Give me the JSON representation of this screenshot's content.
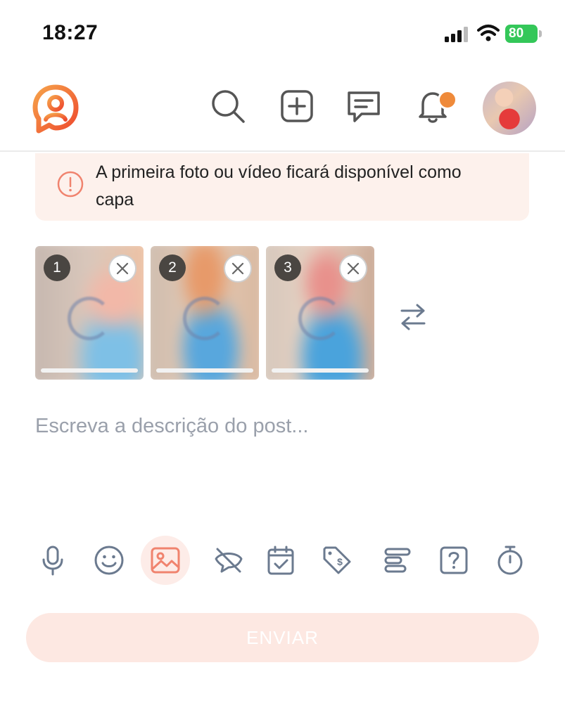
{
  "status_bar": {
    "time": "18:27",
    "battery_level": "80",
    "battery_color": "#34c759"
  },
  "header": {
    "logo": "app-logo",
    "icons": [
      "search-icon",
      "add-icon",
      "chat-icon",
      "bell-icon",
      "avatar"
    ],
    "notification_dot_color": "#ef8a3a"
  },
  "banner": {
    "text": "A primeira foto ou vídeo ficará disponível como capa",
    "icon": "alert-circle-icon",
    "background": "#fdf1ec"
  },
  "media": {
    "items": [
      {
        "index": "1",
        "status": "uploading"
      },
      {
        "index": "2",
        "status": "uploading"
      },
      {
        "index": "3",
        "status": "uploading"
      }
    ],
    "reorder_icon": "swap-arrows-icon"
  },
  "composer": {
    "description_placeholder": "Escreva a descrição do post...",
    "description_value": ""
  },
  "toolbar": {
    "tools": [
      "microphone-icon",
      "emoji-icon",
      "image-icon",
      "hide-icon",
      "calendar-icon",
      "price-tag-icon",
      "align-icon",
      "question-icon",
      "timer-icon"
    ],
    "active_tool": "image-icon",
    "accent_color": "#f0836e"
  },
  "send_button": {
    "label": "ENVIAR",
    "enabled": false
  }
}
